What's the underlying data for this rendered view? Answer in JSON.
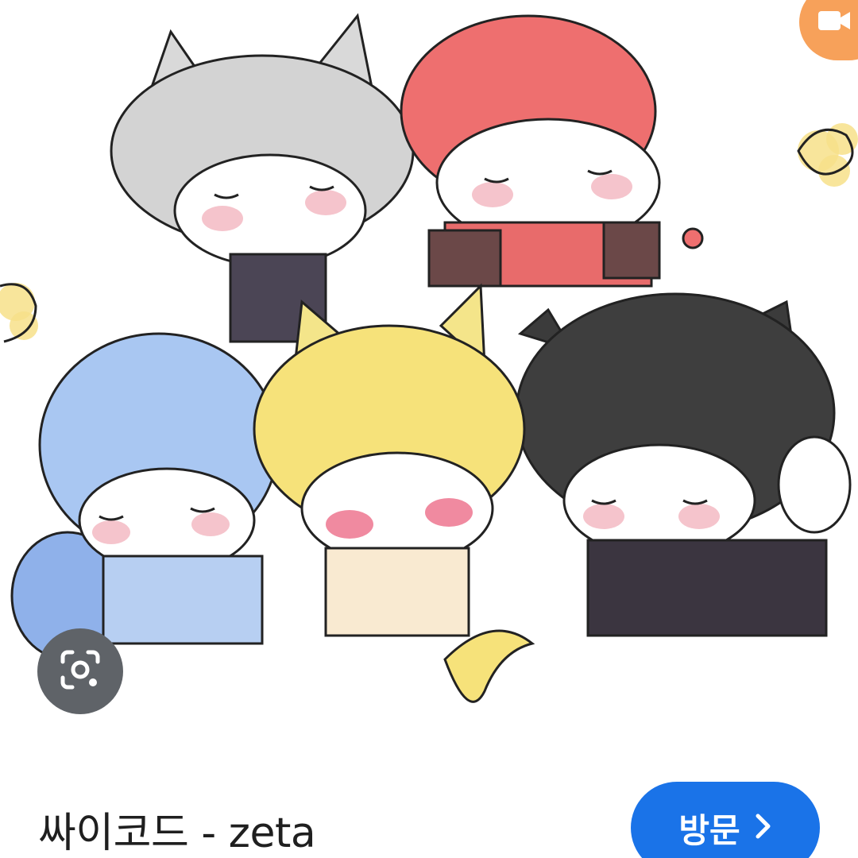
{
  "result": {
    "title": "싸이코드 - zeta",
    "visit_label": "방문",
    "visit_icon": "chevron-right-icon"
  },
  "overlay": {
    "lens_icon": "camera-lens-search-icon",
    "corner_icon": "video-camera-icon"
  },
  "image": {
    "subject": "illustration-five-cat-eared-characters"
  },
  "colors": {
    "accent_blue": "#1a73e8",
    "corner_orange": "#f7a15a",
    "lens_bg": "#5f6368",
    "title_text": "#1f1f1f",
    "background": "#ffffff"
  }
}
